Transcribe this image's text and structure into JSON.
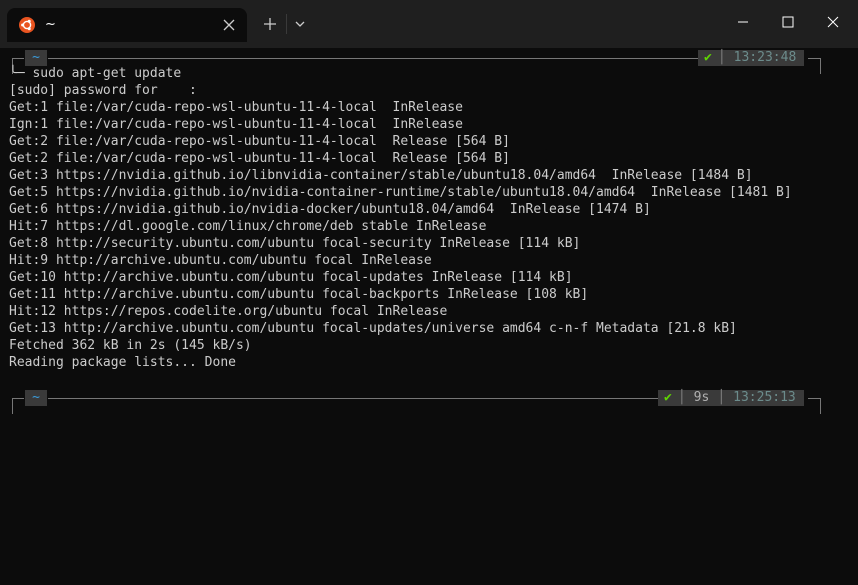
{
  "titlebar": {
    "tab_title": "~",
    "icons": {
      "tab": "ubuntu-icon",
      "close": "close-icon",
      "new_tab": "plus-icon",
      "dropdown": "chevron-down-icon"
    }
  },
  "prompt1": {
    "dir": "~",
    "check": "✔",
    "time": "13:23:48",
    "command": "sudo apt-get update"
  },
  "output": [
    "[sudo] password for    :",
    "Get:1 file:/var/cuda-repo-wsl-ubuntu-11-4-local  InRelease",
    "Ign:1 file:/var/cuda-repo-wsl-ubuntu-11-4-local  InRelease",
    "Get:2 file:/var/cuda-repo-wsl-ubuntu-11-4-local  Release [564 B]",
    "Get:2 file:/var/cuda-repo-wsl-ubuntu-11-4-local  Release [564 B]",
    "Get:3 https://nvidia.github.io/libnvidia-container/stable/ubuntu18.04/amd64  InRelease [1484 B]",
    "Get:5 https://nvidia.github.io/nvidia-container-runtime/stable/ubuntu18.04/amd64  InRelease [1481 B]",
    "Get:6 https://nvidia.github.io/nvidia-docker/ubuntu18.04/amd64  InRelease [1474 B]",
    "Hit:7 https://dl.google.com/linux/chrome/deb stable InRelease",
    "Get:8 http://security.ubuntu.com/ubuntu focal-security InRelease [114 kB]",
    "Hit:9 http://archive.ubuntu.com/ubuntu focal InRelease",
    "Get:10 http://archive.ubuntu.com/ubuntu focal-updates InRelease [114 kB]",
    "Get:11 http://archive.ubuntu.com/ubuntu focal-backports InRelease [108 kB]",
    "Hit:12 https://repos.codelite.org/ubuntu focal InRelease",
    "Get:13 http://archive.ubuntu.com/ubuntu focal-updates/universe amd64 c-n-f Metadata [21.8 kB]",
    "Fetched 362 kB in 2s (145 kB/s)",
    "Reading package lists... Done"
  ],
  "prompt2": {
    "dir": "~",
    "check": "✔",
    "duration": "9s",
    "time": "13:25:13"
  },
  "colors": {
    "background": "#0c0c0c",
    "titlebar": "#1f1f1f",
    "ubuntu": "#e95420",
    "check": "#5fd700",
    "dir": "#3b9ddd"
  }
}
